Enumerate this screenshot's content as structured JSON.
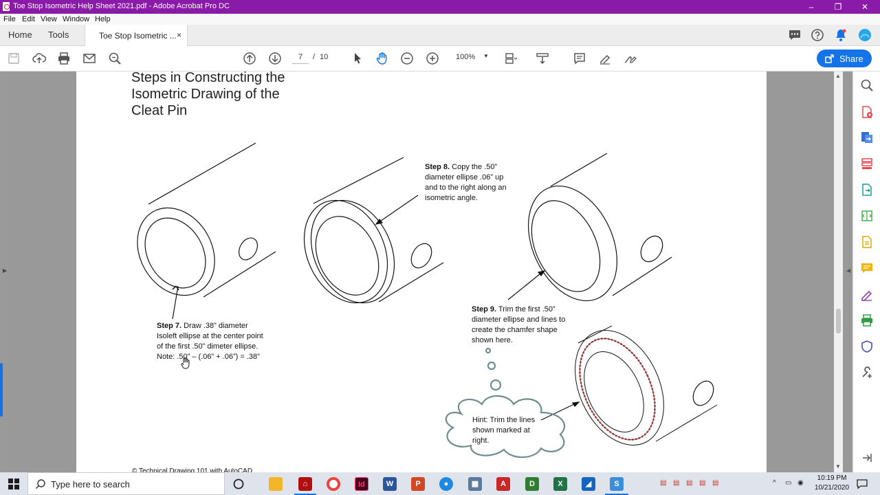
{
  "window": {
    "title": "Toe Stop Isometric Help Sheet 2021.pdf - Adobe Acrobat Pro DC",
    "controls": [
      "–",
      "❐",
      "✕"
    ]
  },
  "menu": [
    "File",
    "Edit",
    "View",
    "Window",
    "Help"
  ],
  "tabs": {
    "home": "Home",
    "tools": "Tools",
    "document": "Toe Stop Isometric ...",
    "close": "×"
  },
  "toolbar": {
    "page_current": "7",
    "page_sep": "/",
    "page_total": "10",
    "zoom": "100%",
    "zoom_caret": "▼",
    "share_label": "Share"
  },
  "document": {
    "title_lines": [
      "Steps in Constructing the",
      "Isometric Drawing of the",
      "Cleat Pin"
    ],
    "step7_head": "Step 7.",
    "step7_text": [
      " Draw .38” diameter",
      "Isoleft ellipse at the center point",
      "of the first .50” dimeter ellipse.",
      "Note: .50” – (.06” + .06”) = .38”"
    ],
    "step8_head": "Step 8.",
    "step8_text": [
      " Copy the .50”",
      "diameter ellipse .06” up",
      "and to the right along an",
      "isometric angle."
    ],
    "step9_head": "Step 9.",
    "step9_text": [
      " Trim the first .50”",
      "diameter ellipse and lines to",
      "create the chamfer shape",
      "shown here."
    ],
    "hint_text": [
      "Hint: Trim the lines",
      "shown marked at",
      "right."
    ],
    "footer": "© Technical Drawing 101 with AutoCAD"
  },
  "taskbar": {
    "search_placeholder": "Type here to search",
    "time": "10:19 PM",
    "date": "10/21/2020"
  },
  "colors": {
    "titlebar": "#8a1aa8",
    "accent": "#1473e6",
    "chamfer_marks": "#d9534f"
  }
}
